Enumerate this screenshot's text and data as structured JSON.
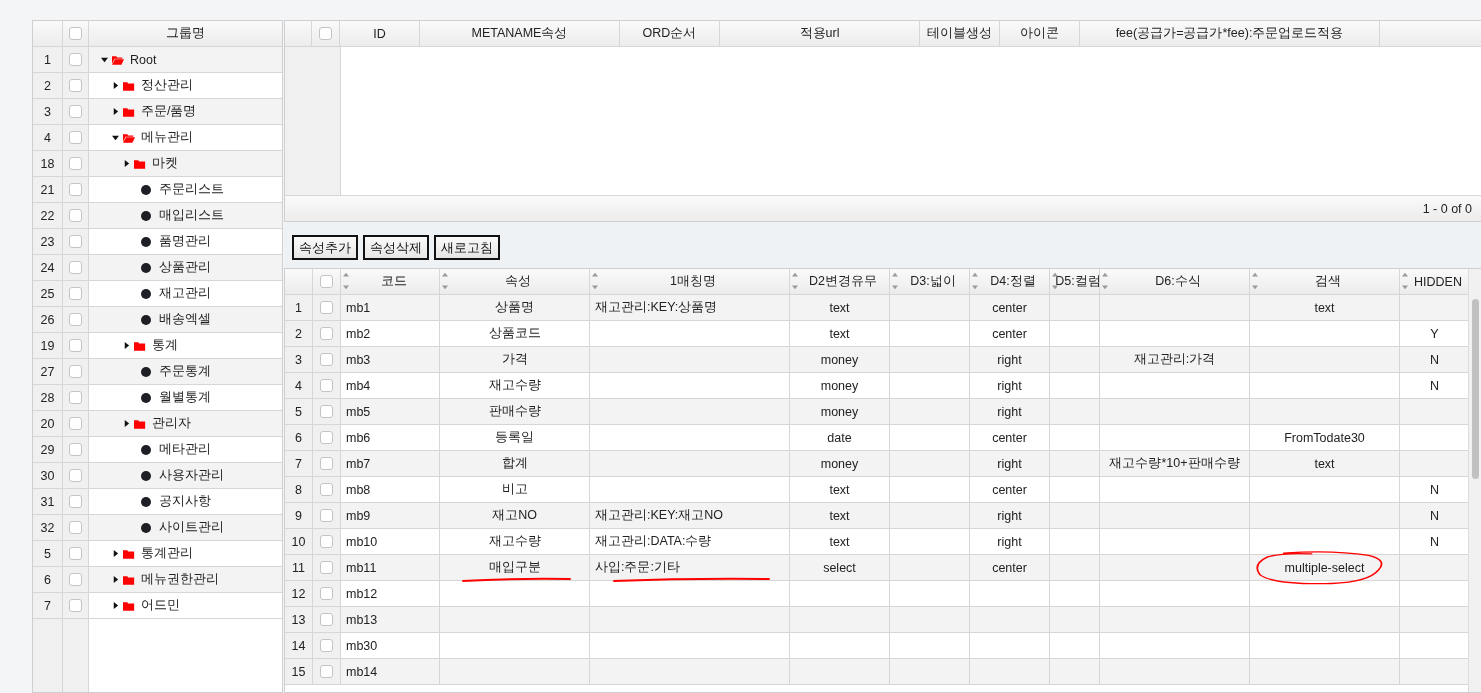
{
  "tree_panel": {
    "header": {
      "label": "그룹명",
      "checked": false
    },
    "tree": [
      {
        "num": "1",
        "label": "Root",
        "kind": "folder",
        "expanded": true,
        "checked": false,
        "children": [
          {
            "num": "2",
            "label": "정산관리",
            "kind": "folder",
            "expanded": false,
            "checked": false
          },
          {
            "num": "3",
            "label": "주문/품명",
            "kind": "folder",
            "expanded": false,
            "checked": false
          },
          {
            "num": "4",
            "label": "메뉴관리",
            "kind": "folder",
            "expanded": true,
            "checked": false,
            "children": [
              {
                "num": "18",
                "label": "마켓",
                "kind": "folder",
                "expanded": false,
                "checked": false
              },
              {
                "num": "21",
                "label": "주문리스트",
                "kind": "item",
                "checked": false
              },
              {
                "num": "22",
                "label": "매입리스트",
                "kind": "item",
                "checked": false
              },
              {
                "num": "23",
                "label": "품명관리",
                "kind": "item",
                "checked": false
              },
              {
                "num": "24",
                "label": "상품관리",
                "kind": "item",
                "checked": false
              },
              {
                "num": "25",
                "label": "재고관리",
                "kind": "item",
                "checked": false
              },
              {
                "num": "26",
                "label": "배송엑셀",
                "kind": "item",
                "checked": false
              },
              {
                "num": "19",
                "label": "통계",
                "kind": "folder",
                "expanded": false,
                "checked": false
              },
              {
                "num": "27",
                "label": "주문통계",
                "kind": "item",
                "checked": false
              },
              {
                "num": "28",
                "label": "월별통계",
                "kind": "item",
                "checked": false
              },
              {
                "num": "20",
                "label": "관리자",
                "kind": "folder",
                "expanded": false,
                "checked": false
              },
              {
                "num": "29",
                "label": "메타관리",
                "kind": "item",
                "checked": false
              },
              {
                "num": "30",
                "label": "사용자관리",
                "kind": "item",
                "checked": false
              },
              {
                "num": "31",
                "label": "공지사항",
                "kind": "item",
                "checked": false
              },
              {
                "num": "32",
                "label": "사이트관리",
                "kind": "item",
                "checked": false
              }
            ]
          },
          {
            "num": "5",
            "label": "통계관리",
            "kind": "folder",
            "expanded": false,
            "checked": false
          },
          {
            "num": "6",
            "label": "메뉴권한관리",
            "kind": "folder",
            "expanded": false,
            "checked": false
          },
          {
            "num": "7",
            "label": "어드민",
            "kind": "folder",
            "expanded": false,
            "checked": false
          }
        ]
      }
    ]
  },
  "meta_table": {
    "header_checked": false,
    "columns": [
      "ID",
      "METANAME속성",
      "ORD순서",
      "적용url",
      "테이블생성",
      "아이콘",
      "fee(공급가=공급가*fee):주문업로드적용"
    ],
    "pager": "1 - 0 of 0"
  },
  "toolbar": {
    "buttons": [
      "속성추가",
      "속성삭제",
      "새로고침"
    ]
  },
  "attr_table": {
    "header_checked": false,
    "columns": [
      "코드",
      "속성",
      "1매칭명",
      "D2변경유무",
      "D3:넓이",
      "D4:정렬",
      "D5:컬럼",
      "D6:수식",
      "검색",
      "HIDDEN"
    ],
    "rows": [
      {
        "num": "1",
        "checked": false,
        "cells": [
          "mb1",
          "상품명",
          "재고관리:KEY:상품명",
          "text",
          null,
          "center",
          null,
          null,
          "text",
          null
        ]
      },
      {
        "num": "2",
        "checked": false,
        "cells": [
          "mb2",
          "상품코드",
          null,
          "text",
          null,
          "center",
          null,
          null,
          null,
          "Y"
        ]
      },
      {
        "num": "3",
        "checked": false,
        "cells": [
          "mb3",
          "가격",
          null,
          "money",
          null,
          "right",
          null,
          "재고관리:가격",
          null,
          "N"
        ]
      },
      {
        "num": "4",
        "checked": false,
        "cells": [
          "mb4",
          "재고수량",
          null,
          "money",
          null,
          "right",
          null,
          null,
          null,
          "N"
        ]
      },
      {
        "num": "5",
        "checked": false,
        "cells": [
          "mb5",
          "판매수량",
          null,
          "money",
          null,
          "right",
          null,
          null,
          null,
          null
        ]
      },
      {
        "num": "6",
        "checked": false,
        "cells": [
          "mb6",
          "등록일",
          null,
          "date",
          null,
          "center",
          null,
          null,
          "FromTodate30",
          null
        ]
      },
      {
        "num": "7",
        "checked": false,
        "cells": [
          "mb7",
          "합계",
          null,
          "money",
          null,
          "right",
          null,
          "재고수량*10+판매수량",
          "text",
          null
        ]
      },
      {
        "num": "8",
        "checked": false,
        "cells": [
          "mb8",
          "비고",
          null,
          "text",
          null,
          "center",
          null,
          null,
          null,
          "N"
        ]
      },
      {
        "num": "9",
        "checked": false,
        "cells": [
          "mb9",
          "재고NO",
          "재고관리:KEY:재고NO",
          "text",
          null,
          "right",
          null,
          null,
          null,
          "N"
        ]
      },
      {
        "num": "10",
        "checked": false,
        "cells": [
          "mb10",
          "재고수량",
          "재고관리:DATA:수량",
          "text",
          null,
          "right",
          null,
          null,
          null,
          "N"
        ]
      },
      {
        "num": "11",
        "checked": false,
        "cells": [
          "mb11",
          {
            "text": "매입구분",
            "underlined": true,
            "circled": false
          },
          {
            "text": "사입:주문:기타",
            "underlined": true,
            "circled": false
          },
          "select",
          null,
          "center",
          null,
          null,
          {
            "text": "multiple-select",
            "underlined": false,
            "circled": true
          },
          null
        ]
      },
      {
        "num": "12",
        "checked": false,
        "cells": [
          "mb12",
          null,
          null,
          null,
          null,
          null,
          null,
          null,
          null,
          null
        ]
      },
      {
        "num": "13",
        "checked": false,
        "cells": [
          "mb13",
          null,
          null,
          null,
          null,
          null,
          null,
          null,
          null,
          null
        ]
      },
      {
        "num": "14",
        "checked": false,
        "cells": [
          "mb30",
          null,
          null,
          null,
          null,
          null,
          null,
          null,
          null,
          null
        ]
      },
      {
        "num": "15",
        "checked": false,
        "cells": [
          "mb14",
          null,
          null,
          null,
          null,
          null,
          null,
          null,
          null,
          null
        ]
      }
    ]
  }
}
